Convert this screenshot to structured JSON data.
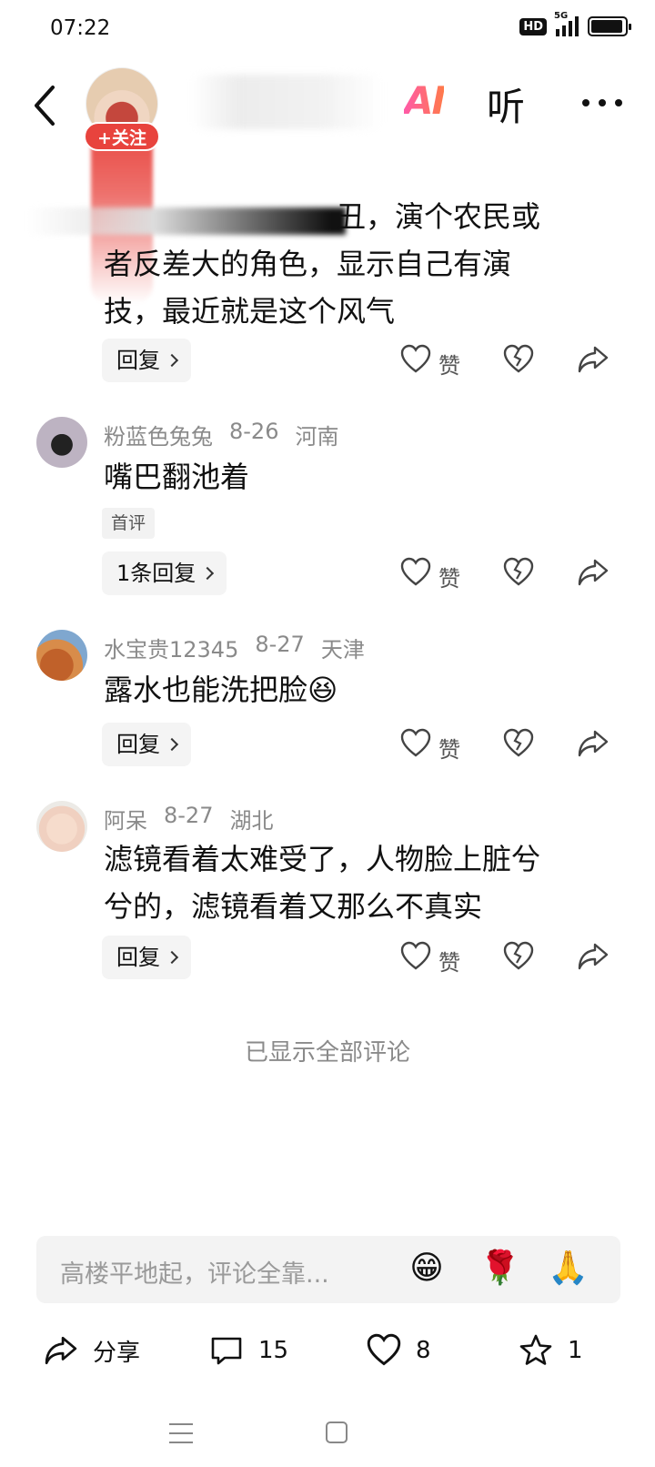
{
  "status_bar": {
    "time": "07:22",
    "hd": "HD",
    "network": "5G"
  },
  "nav": {
    "follow_label": "+关注",
    "ai_label": "AI",
    "listen_label": "听"
  },
  "top_comment": {
    "lines": [
      "丑，演个农民或",
      "者反差大的角色，显示自己有演",
      "技，最近就是这个风气"
    ],
    "reply_label": "回复",
    "like_label": "赞"
  },
  "comments": [
    {
      "user": "粉蓝色兔兔",
      "date": "8-26",
      "location": "河南",
      "text": "嘴巴翻池着",
      "tag": "首评",
      "reply_label": "1条回复",
      "like_label": "赞"
    },
    {
      "user": "水宝贵12345",
      "date": "8-27",
      "location": "天津",
      "text": "露水也能洗把脸",
      "emoji": "😆",
      "reply_label": "回复",
      "like_label": "赞"
    },
    {
      "user": "阿呆",
      "date": "8-27",
      "location": "湖北",
      "lines": [
        "滤镜看着太难受了，人物脸上脏兮",
        "兮的，滤镜看着又那么不真实"
      ],
      "reply_label": "回复",
      "like_label": "赞"
    }
  ],
  "all_shown_label": "已显示全部评论",
  "input": {
    "placeholder": "高楼平地起，评论全靠...",
    "emojis": [
      "😁",
      "🌹",
      "🙏"
    ]
  },
  "bottom_bar": {
    "share_label": "分享",
    "comment_count": "15",
    "like_count": "8",
    "favorite_count": "1"
  },
  "icons": [
    "back-icon",
    "ai-icon",
    "more-icon",
    "heart-icon",
    "broken-heart-icon",
    "share-arrow-icon",
    "comment-icon",
    "star-icon",
    "menu-icon",
    "home-icon"
  ]
}
